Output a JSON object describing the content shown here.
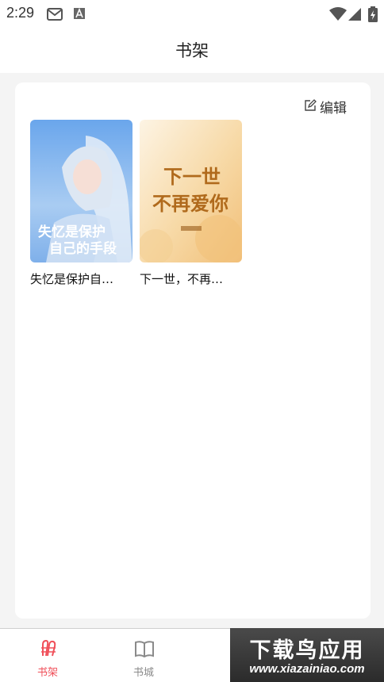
{
  "status_bar": {
    "time": "2:29",
    "icons": [
      "gmail-icon",
      "a-notification-icon",
      "wifi-icon",
      "signal-icon",
      "battery-icon"
    ]
  },
  "header": {
    "title": "书架"
  },
  "shelf": {
    "edit_label": "编辑",
    "books": [
      {
        "title": "失忆是保护自…",
        "cover_text_line1": "失忆是保护",
        "cover_text_line2": "自己的手段",
        "cover_colors": [
          "#7fb2ec",
          "#c8ddf5"
        ]
      },
      {
        "title": "下一世，不再…",
        "cover_text_line1": "下一世",
        "cover_text_line2": "不再爱你",
        "cover_colors": [
          "#fbeed6",
          "#f3c98a"
        ]
      }
    ]
  },
  "bottom_nav": {
    "items": [
      {
        "label": "书架",
        "icon": "bookshelf-icon",
        "active": true
      },
      {
        "label": "书城",
        "icon": "book-open-icon",
        "active": false
      }
    ],
    "active_color": "#f0505a",
    "inactive_color": "#8a8a8a"
  },
  "watermark": {
    "title": "下载鸟应用",
    "url": "www.xiazainiao.com"
  }
}
